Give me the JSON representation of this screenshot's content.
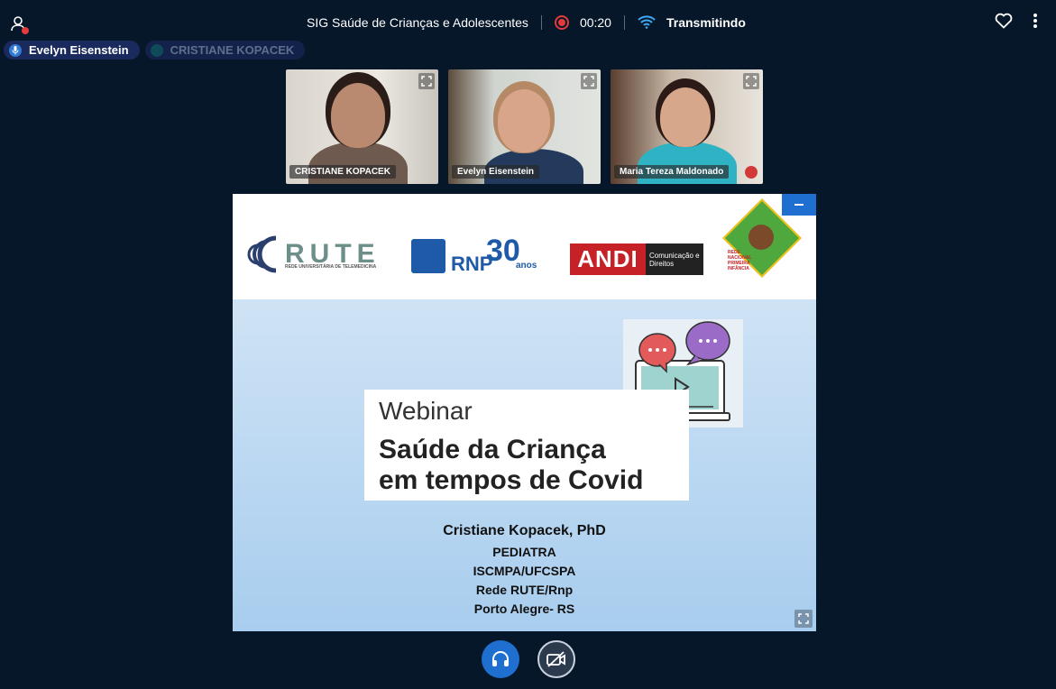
{
  "header": {
    "meeting_title": "SIG Saúde de Crianças e Adolescentes",
    "timer": "00:20",
    "status": "Transmitindo",
    "icons": [
      "user-icon",
      "record-icon",
      "wifi-icon",
      "heart-icon",
      "more-vertical-icon"
    ]
  },
  "speakers": [
    {
      "label": "Evelyn Eisenstein",
      "active": true
    },
    {
      "label": "CRISTIANE KOPACEK",
      "active": false
    }
  ],
  "participants": [
    {
      "name": "CRISTIANE KOPACEK",
      "muted": false
    },
    {
      "name": "Evelyn Eisenstein",
      "muted": false
    },
    {
      "name": "Maria Tereza Maldonado",
      "muted": true
    }
  ],
  "slide": {
    "logos": {
      "rute": "RUTE",
      "rute_sub": "REDE UNIVERSITÁRIA DE TELEMEDICINA",
      "rnp": "RNP",
      "rnp_years": "30",
      "rnp_anos": "anos",
      "andi": "ANDI",
      "andi_sub": "Comunicação e Direitos",
      "rnpi_sub": "REDE NACIONAL PRIMEIRA INFÂNCIA"
    },
    "webinar_label": "Webinar",
    "title_line1": "Saúde da Criança",
    "title_line2": "em tempos de Covid",
    "presenter": "Cristiane Kopacek, PhD",
    "details": [
      "PEDIATRA",
      "ISCMPA/UFCSPA",
      "Rede RUTE/Rnp",
      "Porto Alegre- RS"
    ]
  },
  "controls": {
    "audio_icon": "headphones-icon",
    "video_icon": "camera-off-icon"
  },
  "colors": {
    "background": "#06172a",
    "accent": "#1e6fd0",
    "record": "#e23b3b",
    "wifi": "#3fa9f5"
  }
}
